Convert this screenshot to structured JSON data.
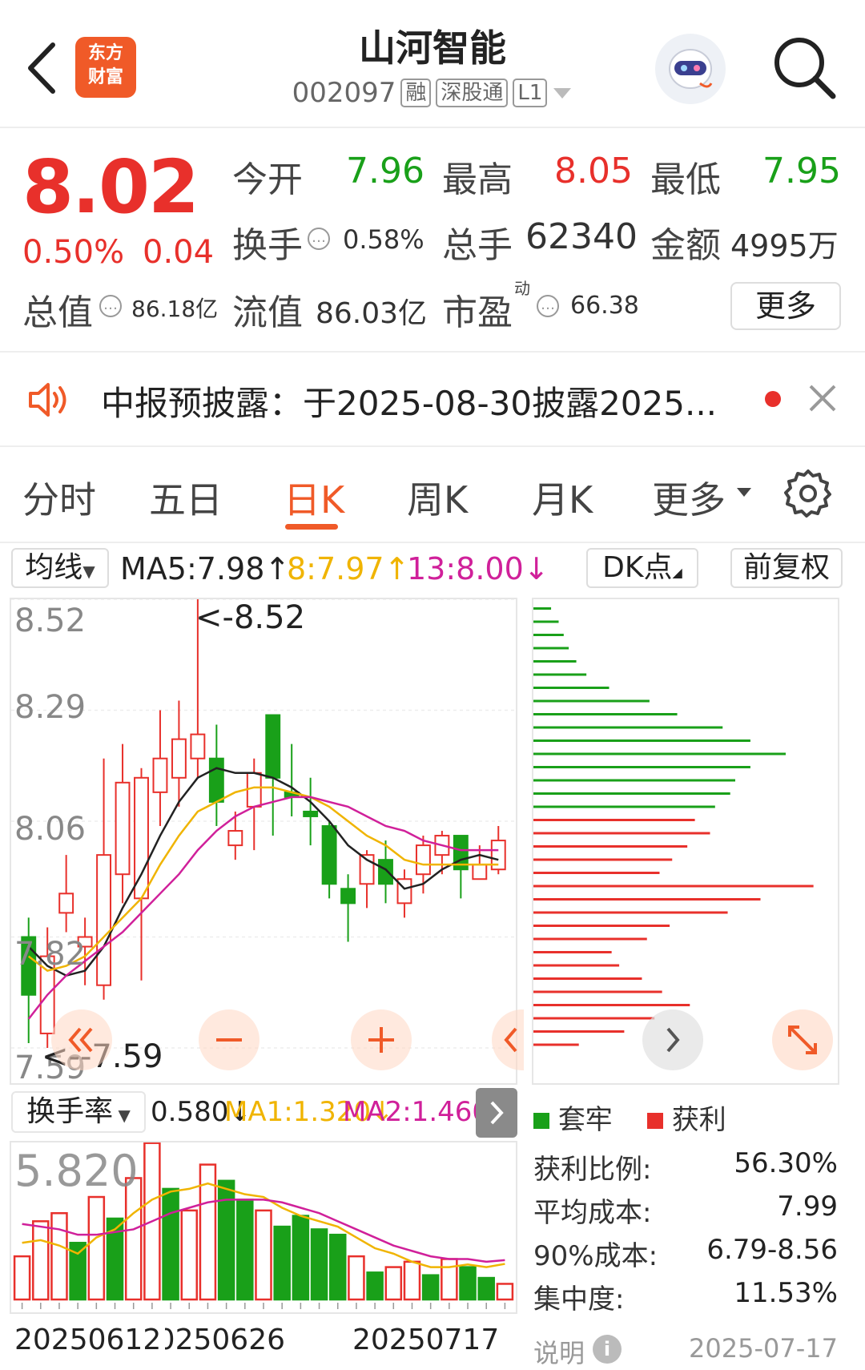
{
  "header": {
    "stock_name": "山河智能",
    "stock_code": "002097",
    "tags": [
      "融",
      "深股通",
      "L1"
    ],
    "brand_line1": "东方",
    "brand_line2": "财富"
  },
  "quote": {
    "price": "8.02",
    "change_pct": "0.50%",
    "change_amt": "0.04",
    "open_label": "今开",
    "open": "7.96",
    "high_label": "最高",
    "high": "8.05",
    "low_label": "最低",
    "low": "7.95",
    "turnover_label": "换手",
    "turnover": "0.58%",
    "volume_label": "总手",
    "volume": "62340",
    "amount_label": "金额",
    "amount": "4995万",
    "total_cap_label": "总值",
    "total_cap": "86.18亿",
    "float_cap_label": "流值",
    "float_cap": "86.03亿",
    "pe_label": "市盈",
    "pe_sup": "动",
    "pe": "66.38",
    "more_label": "更多"
  },
  "notice": {
    "text": "中报预披露：于2025-08-30披露2025..."
  },
  "tabs": [
    "分时",
    "五日",
    "日K",
    "周K",
    "月K",
    "更多"
  ],
  "active_tab": "日K",
  "indicator_bar": {
    "ma_select": "均线",
    "ma5": "MA5:7.98↑",
    "ma8": "8:7.97↑",
    "ma13": "13:8.00↓",
    "dk_label": "DK点",
    "adjust_label": "前复权"
  },
  "kline": {
    "y_labels": [
      "8.52",
      "8.29",
      "8.06",
      "7.82",
      "7.59"
    ],
    "max_marker": "<-8.52",
    "min_marker": "<--7.59"
  },
  "turnover_panel": {
    "select_label": "换手率",
    "value": "0.580↓",
    "ma1": "MA1:1.320↓",
    "ma2": "MA2:1.460↓",
    "y_label": "5.820",
    "dates": [
      "20250612",
      "20250626",
      "20250717"
    ]
  },
  "chip_panel": {
    "legend_trapped": "套牢",
    "legend_profit": "获利",
    "profit_ratio_label": "获利比例:",
    "profit_ratio": "56.30%",
    "avg_cost_label": "平均成本:",
    "avg_cost": "7.99",
    "cost90_label": "90%成本:",
    "cost90": "6.79-8.56",
    "concentration_label": "集中度:",
    "concentration": "11.53%",
    "note_label": "说明",
    "date": "2025-07-17"
  },
  "colors": {
    "up": "#e8302b",
    "down": "#19a019",
    "accent": "#f05a28",
    "ma5": "#222222",
    "ma8": "#f0b400",
    "ma13": "#d0209a"
  },
  "chart_data": [
    {
      "type": "candlestick",
      "title": "日K",
      "ylim": [
        7.59,
        8.52
      ],
      "y_ticks": [
        8.52,
        8.29,
        8.06,
        7.82,
        7.59
      ],
      "candles": [
        {
          "o": 7.82,
          "c": 7.7,
          "h": 7.86,
          "l": 7.6
        },
        {
          "o": 7.62,
          "c": 7.78,
          "h": 7.84,
          "l": 7.59
        },
        {
          "o": 7.87,
          "c": 7.91,
          "h": 7.99,
          "l": 7.83
        },
        {
          "o": 7.8,
          "c": 7.82,
          "h": 7.86,
          "l": 7.72
        },
        {
          "o": 7.72,
          "c": 7.99,
          "h": 8.19,
          "l": 7.69
        },
        {
          "o": 7.95,
          "c": 8.14,
          "h": 8.22,
          "l": 7.89
        },
        {
          "o": 7.9,
          "c": 8.15,
          "h": 8.17,
          "l": 7.73
        },
        {
          "o": 8.12,
          "c": 8.19,
          "h": 8.29,
          "l": 8.05
        },
        {
          "o": 8.15,
          "c": 8.23,
          "h": 8.31,
          "l": 8.09
        },
        {
          "o": 8.19,
          "c": 8.24,
          "h": 8.52,
          "l": 8.15
        },
        {
          "o": 8.19,
          "c": 8.1,
          "h": 8.26,
          "l": 8.05
        },
        {
          "o": 8.01,
          "c": 8.04,
          "h": 8.08,
          "l": 7.98
        },
        {
          "o": 8.09,
          "c": 8.16,
          "h": 8.19,
          "l": 8.0
        },
        {
          "o": 8.28,
          "c": 8.15,
          "h": 8.28,
          "l": 8.03
        },
        {
          "o": 8.12,
          "c": 8.11,
          "h": 8.22,
          "l": 8.07
        },
        {
          "o": 8.08,
          "c": 8.07,
          "h": 8.15,
          "l": 8.01
        },
        {
          "o": 8.05,
          "c": 7.93,
          "h": 8.06,
          "l": 7.9
        },
        {
          "o": 7.92,
          "c": 7.89,
          "h": 7.95,
          "l": 7.81
        },
        {
          "o": 7.93,
          "c": 7.99,
          "h": 8.0,
          "l": 7.88
        },
        {
          "o": 7.98,
          "c": 7.93,
          "h": 8.02,
          "l": 7.89
        },
        {
          "o": 7.89,
          "c": 7.94,
          "h": 7.96,
          "l": 7.86
        },
        {
          "o": 7.95,
          "c": 8.01,
          "h": 8.03,
          "l": 7.91
        },
        {
          "o": 7.99,
          "c": 8.03,
          "h": 8.04,
          "l": 7.95
        },
        {
          "o": 8.03,
          "c": 7.96,
          "h": 8.03,
          "l": 7.9
        },
        {
          "o": 7.94,
          "c": 7.97,
          "h": 8.01,
          "l": 7.94
        },
        {
          "o": 7.96,
          "c": 8.02,
          "h": 8.05,
          "l": 7.95
        }
      ],
      "ma5": [
        7.8,
        7.76,
        7.74,
        7.75,
        7.8,
        7.88,
        7.95,
        8.03,
        8.1,
        8.15,
        8.17,
        8.16,
        8.16,
        8.15,
        8.13,
        8.1,
        8.06,
        8.01,
        7.98,
        7.96,
        7.92,
        7.93,
        7.96,
        7.98,
        7.99,
        7.98
      ],
      "ma8": [
        7.78,
        7.75,
        7.76,
        7.78,
        7.82,
        7.86,
        7.9,
        7.97,
        8.03,
        8.08,
        8.1,
        8.12,
        8.13,
        8.13,
        8.12,
        8.11,
        8.09,
        8.06,
        8.03,
        8.01,
        7.98,
        7.97,
        7.97,
        7.97,
        7.97,
        7.97
      ],
      "ma13": [
        7.65,
        7.7,
        7.74,
        7.77,
        7.8,
        7.83,
        7.87,
        7.91,
        7.95,
        8.0,
        8.04,
        8.07,
        8.09,
        8.1,
        8.11,
        8.11,
        8.1,
        8.09,
        8.07,
        8.05,
        8.04,
        8.02,
        8.01,
        8.0,
        8.0,
        8.0
      ]
    },
    {
      "type": "bar",
      "title": "换手率",
      "ylim": [
        0,
        5.82
      ],
      "values": [
        1.6,
        2.9,
        3.2,
        2.1,
        3.8,
        3.0,
        4.5,
        5.8,
        4.1,
        3.3,
        5.0,
        4.4,
        3.7,
        3.3,
        2.7,
        3.1,
        2.6,
        2.4,
        1.6,
        1.0,
        1.2,
        1.4,
        0.9,
        1.5,
        1.2,
        0.8,
        0.58
      ],
      "up": [
        true,
        true,
        true,
        false,
        true,
        false,
        true,
        true,
        false,
        true,
        true,
        false,
        false,
        true,
        false,
        false,
        false,
        false,
        true,
        false,
        true,
        true,
        false,
        true,
        false,
        false,
        true
      ],
      "ma1": [
        2.1,
        2.2,
        2.0,
        1.7,
        2.3,
        2.6,
        3.2,
        3.7,
        4.0,
        4.1,
        4.3,
        4.1,
        3.9,
        3.8,
        3.4,
        3.1,
        2.9,
        2.7,
        2.3,
        1.9,
        1.7,
        1.4,
        1.2,
        1.2,
        1.3,
        1.2,
        1.32
      ],
      "ma2": [
        2.8,
        2.7,
        2.6,
        2.4,
        2.4,
        2.5,
        2.6,
        2.9,
        3.2,
        3.4,
        3.6,
        3.7,
        3.7,
        3.7,
        3.6,
        3.4,
        3.2,
        2.9,
        2.6,
        2.3,
        2.0,
        1.8,
        1.6,
        1.5,
        1.5,
        1.4,
        1.46
      ],
      "x_ticks": [
        "20250612",
        "20250626",
        "20250717"
      ]
    },
    {
      "type": "bar",
      "title": "筹码分布",
      "orientation": "horizontal",
      "price_bins_top_to_bottom": [
        8.52,
        8.49,
        8.45,
        8.42,
        8.38,
        8.35,
        8.31,
        8.28,
        8.24,
        8.21,
        8.17,
        8.13,
        8.1,
        8.06,
        8.03,
        7.99,
        7.96,
        7.92,
        7.89,
        7.85,
        7.82,
        7.78,
        7.75,
        7.71,
        7.68,
        7.64,
        7.61,
        7.57,
        7.54,
        7.5,
        7.46,
        7.43,
        7.39,
        7.36
      ],
      "values": [
        0.07,
        0.1,
        0.12,
        0.14,
        0.17,
        0.21,
        0.3,
        0.46,
        0.57,
        0.75,
        0.86,
        1.0,
        0.86,
        0.8,
        0.78,
        0.72,
        0.64,
        0.7,
        0.61,
        0.55,
        0.5,
        1.11,
        0.9,
        0.77,
        0.54,
        0.45,
        0.31,
        0.34,
        0.43,
        0.51,
        0.62,
        0.48,
        0.36,
        0.18
      ],
      "profit": [
        false,
        false,
        false,
        false,
        false,
        false,
        false,
        false,
        false,
        false,
        false,
        false,
        false,
        false,
        false,
        false,
        true,
        true,
        true,
        true,
        true,
        true,
        true,
        true,
        true,
        true,
        true,
        true,
        true,
        true,
        true,
        true,
        true,
        true
      ]
    }
  ]
}
